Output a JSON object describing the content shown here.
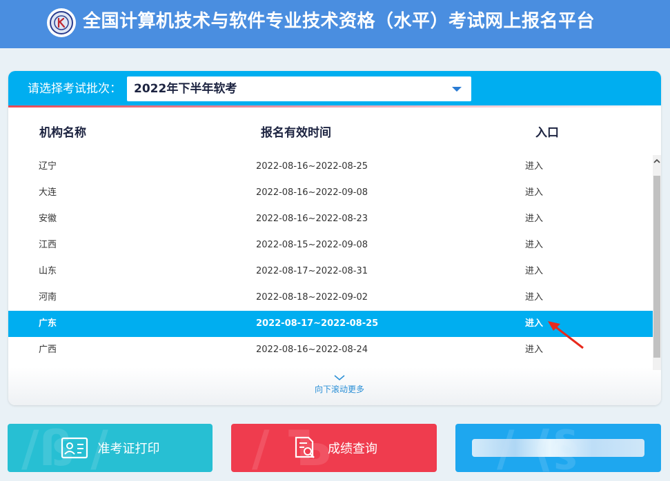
{
  "header": {
    "title": "全国计算机技术与软件专业技术资格（水平）考试网上报名平台"
  },
  "batch": {
    "label": "请选择考试批次：",
    "selected": "2022年下半年软考"
  },
  "table": {
    "columns": [
      "机构名称",
      "报名有效时间",
      "入口"
    ],
    "rows": [
      {
        "org": "辽宁",
        "time": "2022-08-16~2022-08-25",
        "entry": "进入"
      },
      {
        "org": "大连",
        "time": "2022-08-16~2022-09-08",
        "entry": "进入"
      },
      {
        "org": "安徽",
        "time": "2022-08-16~2022-08-23",
        "entry": "进入"
      },
      {
        "org": "江西",
        "time": "2022-08-15~2022-09-08",
        "entry": "进入"
      },
      {
        "org": "山东",
        "time": "2022-08-17~2022-08-31",
        "entry": "进入"
      },
      {
        "org": "河南",
        "time": "2022-08-18~2022-09-02",
        "entry": "进入"
      },
      {
        "org": "广东",
        "time": "2022-08-17~2022-08-25",
        "entry": "进入"
      },
      {
        "org": "广西",
        "time": "2022-08-16~2022-08-24",
        "entry": "进入"
      }
    ],
    "active_row": 6
  },
  "scroll_more": "向下滚动更多",
  "buttons": {
    "ticket": "准考证打印",
    "score": "成绩查询"
  },
  "colors": {
    "header": "#4a8ee0",
    "accent": "#00aef0",
    "ticket_btn": "#27bfd3",
    "score_btn": "#ef3c4e",
    "third_btn": "#1ea7ef",
    "annotation": "#e8291c"
  },
  "icons": {
    "logo": "exam-logo-icon",
    "ticket": "id-card-icon",
    "score": "document-search-icon",
    "dropdown": "caret-down-icon",
    "more": "chevron-down-icon",
    "scroll": "chevron-up-icon"
  }
}
